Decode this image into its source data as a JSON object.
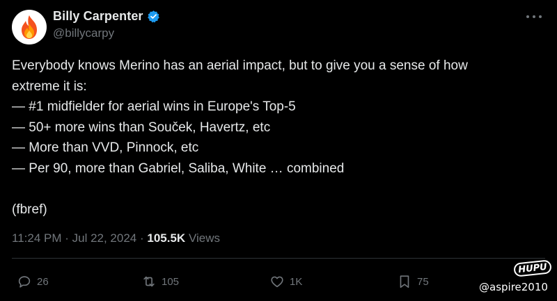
{
  "author": {
    "display_name": "Billy Carpenter",
    "handle": "@billycarpy",
    "avatar_icon": "fire-icon",
    "verified_icon": "verified-badge-icon",
    "verified_color": "#1d9bf0"
  },
  "tweet": {
    "lines": [
      "Everybody knows Merino has an aerial impact, but to give you a sense of how",
      "extreme it is:",
      "— #1 midfielder for aerial wins in Europe's Top-5",
      "— 50+ more wins than Souček, Havertz, etc",
      "— More than VVD, Pinnock, etc",
      "— Per 90, more than Gabriel, Saliba, White … combined"
    ],
    "source": "(fbref)"
  },
  "meta": {
    "time": "11:24 PM",
    "separator": " · ",
    "date": "Jul 22, 2024",
    "views_count": "105.5K",
    "views_label": "Views"
  },
  "actions": {
    "replies": "26",
    "reposts": "105",
    "likes": "1K",
    "bookmarks": "75"
  },
  "watermark": {
    "logo": "HUPU",
    "user": "@aspire2010"
  },
  "colors": {
    "background": "#000000",
    "text": "#e7e9ea",
    "muted": "#71767b",
    "divider": "#2f3336"
  }
}
